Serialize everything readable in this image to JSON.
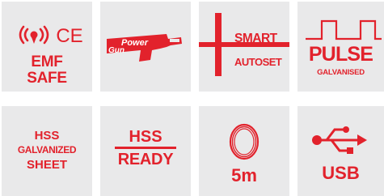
{
  "colors": {
    "accent": "#e2222c",
    "tile_bg": "#e9e9ea"
  },
  "emf": {
    "icons": [
      "radio-waves-icon",
      "ce-mark-icon"
    ],
    "line1": "EMF",
    "line2": "SAFE",
    "ce_mark": "CE"
  },
  "power_gun": {
    "icon": "power-gun-icon",
    "logo_text1": "Power",
    "logo_text2": "Gun"
  },
  "smart_autoset": {
    "icon": "plus-minus-icon",
    "line1": "SMART",
    "line2": "AUTOSET"
  },
  "pulse": {
    "icon": "pulse-wave-icon",
    "line1": "PULSE",
    "line2": "GALVANISED"
  },
  "hss_sheet": {
    "line1": "HSS",
    "line2": "GALVANIZED",
    "line3": "SHEET"
  },
  "hss_ready": {
    "line1": "HSS",
    "line2": "READY"
  },
  "cable": {
    "icon": "cable-coil-icon",
    "length": "5m"
  },
  "usb": {
    "icon": "usb-icon",
    "label": "USB"
  }
}
